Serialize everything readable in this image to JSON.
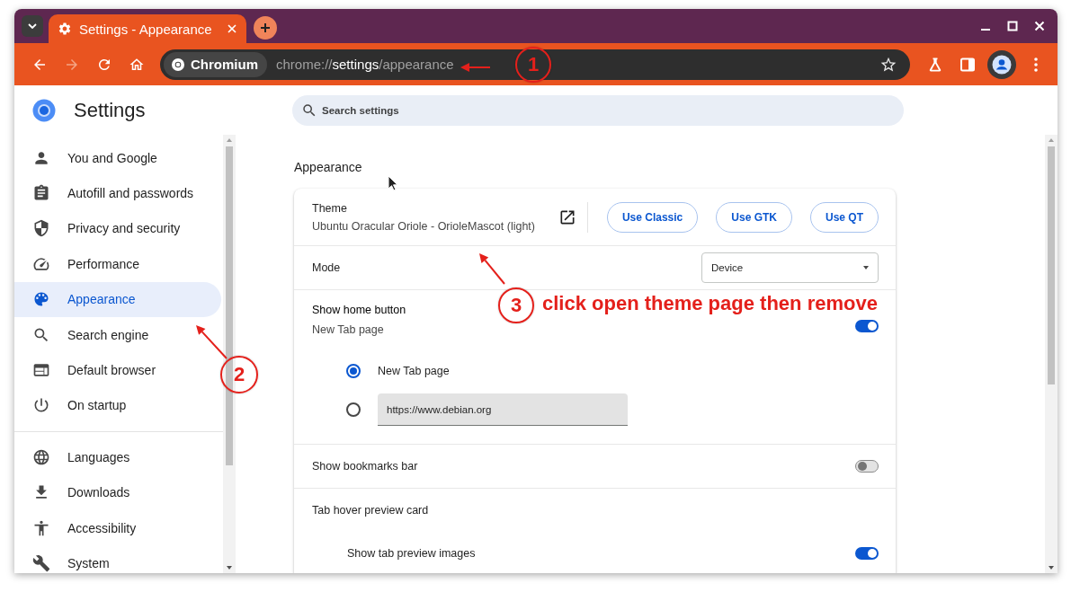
{
  "window": {
    "tab_title": "Settings - Appearance"
  },
  "toolbar": {
    "forward_enabled": false,
    "site_chip": "Chromium",
    "url": {
      "scheme": "chrome://",
      "host": "settings",
      "path": "/appearance"
    }
  },
  "header": {
    "title": "Settings",
    "search": {
      "placeholder": "Search settings"
    }
  },
  "sidebar": {
    "sections": [
      {
        "items": [
          {
            "label": "You and Google",
            "selected": false
          },
          {
            "label": "Autofill and passwords",
            "selected": false
          },
          {
            "label": "Privacy and security",
            "selected": false
          },
          {
            "label": "Performance",
            "selected": false
          },
          {
            "label": "Appearance",
            "selected": true
          },
          {
            "label": "Search engine",
            "selected": false
          },
          {
            "label": "Default browser",
            "selected": false
          },
          {
            "label": "On startup",
            "selected": false
          }
        ]
      },
      {
        "items": [
          {
            "label": "Languages",
            "selected": false
          },
          {
            "label": "Downloads",
            "selected": false
          },
          {
            "label": "Accessibility",
            "selected": false
          },
          {
            "label": "System",
            "selected": false
          }
        ]
      }
    ]
  },
  "page": {
    "heading": "Appearance",
    "rows": [
      {
        "kind": "theme",
        "label": "Theme",
        "value": "Ubuntu Oracular Oriole - OrioleMascot (light)",
        "buttons": [
          "Use Classic",
          "Use GTK",
          "Use QT"
        ]
      },
      {
        "kind": "select",
        "label": "Mode",
        "value": "Device"
      },
      {
        "kind": "toggle",
        "label": "Show home button",
        "sublabel": "New Tab page",
        "on": true,
        "options": [
          {
            "kind": "radio",
            "label": "New Tab page",
            "selected": true
          },
          {
            "kind": "radio-field",
            "value": "https://www.debian.org",
            "selected": false
          }
        ]
      },
      {
        "kind": "toggle",
        "label": "Show bookmarks bar",
        "on": false
      },
      {
        "kind": "heading",
        "label": "Tab hover preview card"
      },
      {
        "kind": "subtoggle",
        "label": "Show tab preview images",
        "on": true
      }
    ]
  },
  "annotations": [
    {
      "number": "1"
    },
    {
      "number": "2"
    },
    {
      "number": "3",
      "note": "click open theme page then remove"
    }
  ]
}
